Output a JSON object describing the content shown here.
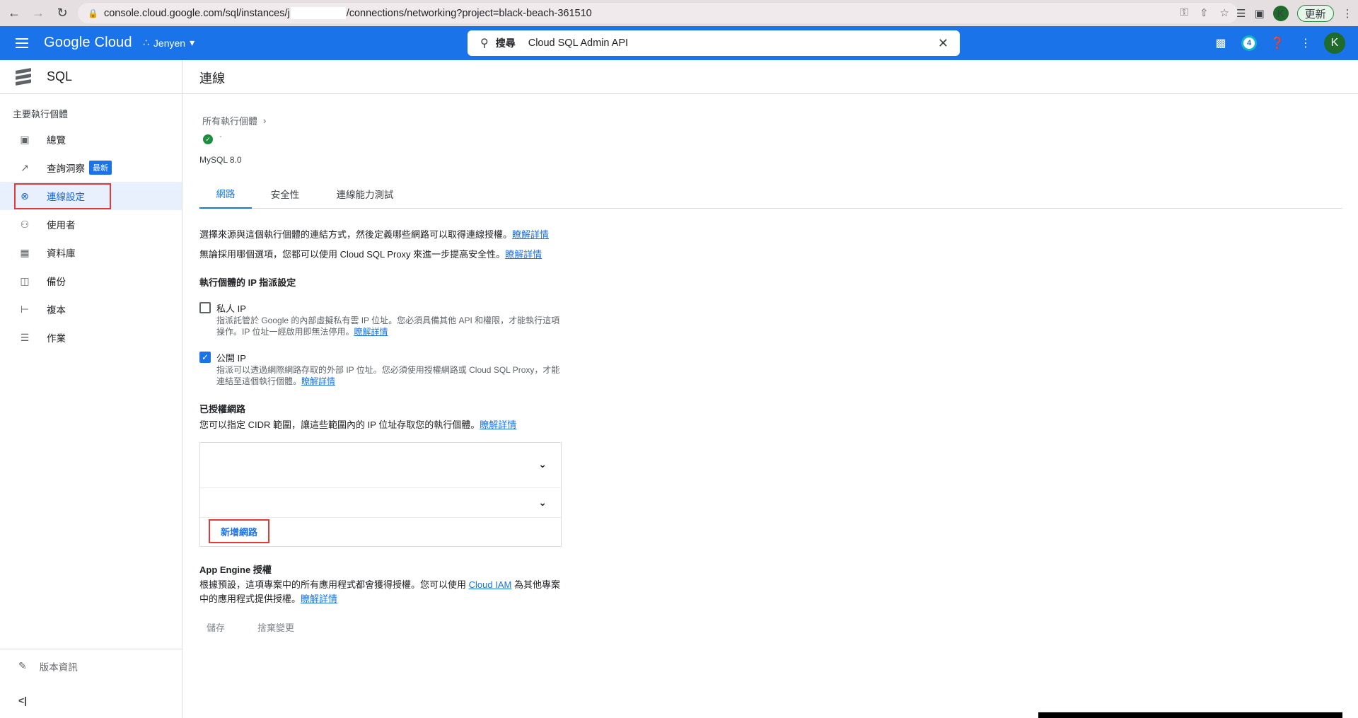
{
  "browser": {
    "url_prefix": "console.cloud.google.com/sql/instances/j",
    "url_suffix": "/connections/networking?project=black-beach-361510",
    "profile_initial": "K",
    "update_label": "更新"
  },
  "header": {
    "logo": "Google Cloud",
    "project": "Jenyen",
    "search_label": "搜尋",
    "search_query": "Cloud SQL Admin API",
    "notification_count": "4",
    "avatar_initial": "K"
  },
  "sidebar": {
    "title": "SQL",
    "section": "主要執行個體",
    "items": [
      {
        "label": "總覽",
        "icon": "overview-icon"
      },
      {
        "label": "查詢洞察",
        "icon": "insights-icon",
        "badge": "最新"
      },
      {
        "label": "連線設定",
        "icon": "connections-icon",
        "active": true
      },
      {
        "label": "使用者",
        "icon": "users-icon"
      },
      {
        "label": "資料庫",
        "icon": "database-icon"
      },
      {
        "label": "備份",
        "icon": "backup-icon"
      },
      {
        "label": "複本",
        "icon": "replicas-icon"
      },
      {
        "label": "作業",
        "icon": "operations-icon"
      }
    ],
    "release_notes": "版本資訊"
  },
  "main": {
    "title": "連線",
    "breadcrumb": "所有執行個體",
    "status_dot": "·",
    "version": "MySQL 8.0",
    "tabs": [
      {
        "label": "網路",
        "active": true
      },
      {
        "label": "安全性"
      },
      {
        "label": "連線能力測試"
      }
    ],
    "desc1": "選擇來源與這個執行個體的連結方式，然後定義哪些網路可以取得連線授權。",
    "desc2": "無論採用哪個選項，您都可以使用 Cloud SQL Proxy 來進一步提高安全性。",
    "learn_more": "瞭解詳情",
    "ip_section": "執行個體的 IP 指派設定",
    "private_ip": {
      "label": "私人 IP",
      "checked": false,
      "help_line1": "指派託管於 Google 的內部虛擬私有雲 IP 位址。您必須具備其他 API 和權限，才能執行這項",
      "help_line2": "操作。IP 位址一經啟用即無法停用。"
    },
    "public_ip": {
      "label": "公開 IP",
      "checked": true,
      "help_line1": "指派可以透過網際網路存取的外部 IP 位址。您必須使用授權網路或 Cloud SQL Proxy，才能",
      "help_line2": "連結至這個執行個體。"
    },
    "auth_networks_title": "已授權網路",
    "auth_networks_desc": "您可以指定 CIDR 範圍，讓這些範圍內的 IP 位址存取您的執行個體。",
    "add_network": "新增網路",
    "app_engine_title": "App Engine 授權",
    "app_engine_line1a": "根據預設，這項專案中的所有應用程式都會獲得授權。您可以使用",
    "app_engine_link": "Cloud IAM",
    "app_engine_line1b": "為其他專案",
    "app_engine_line2": "中的應用程式提供授權。",
    "save": "儲存",
    "discard": "捨棄變更"
  }
}
